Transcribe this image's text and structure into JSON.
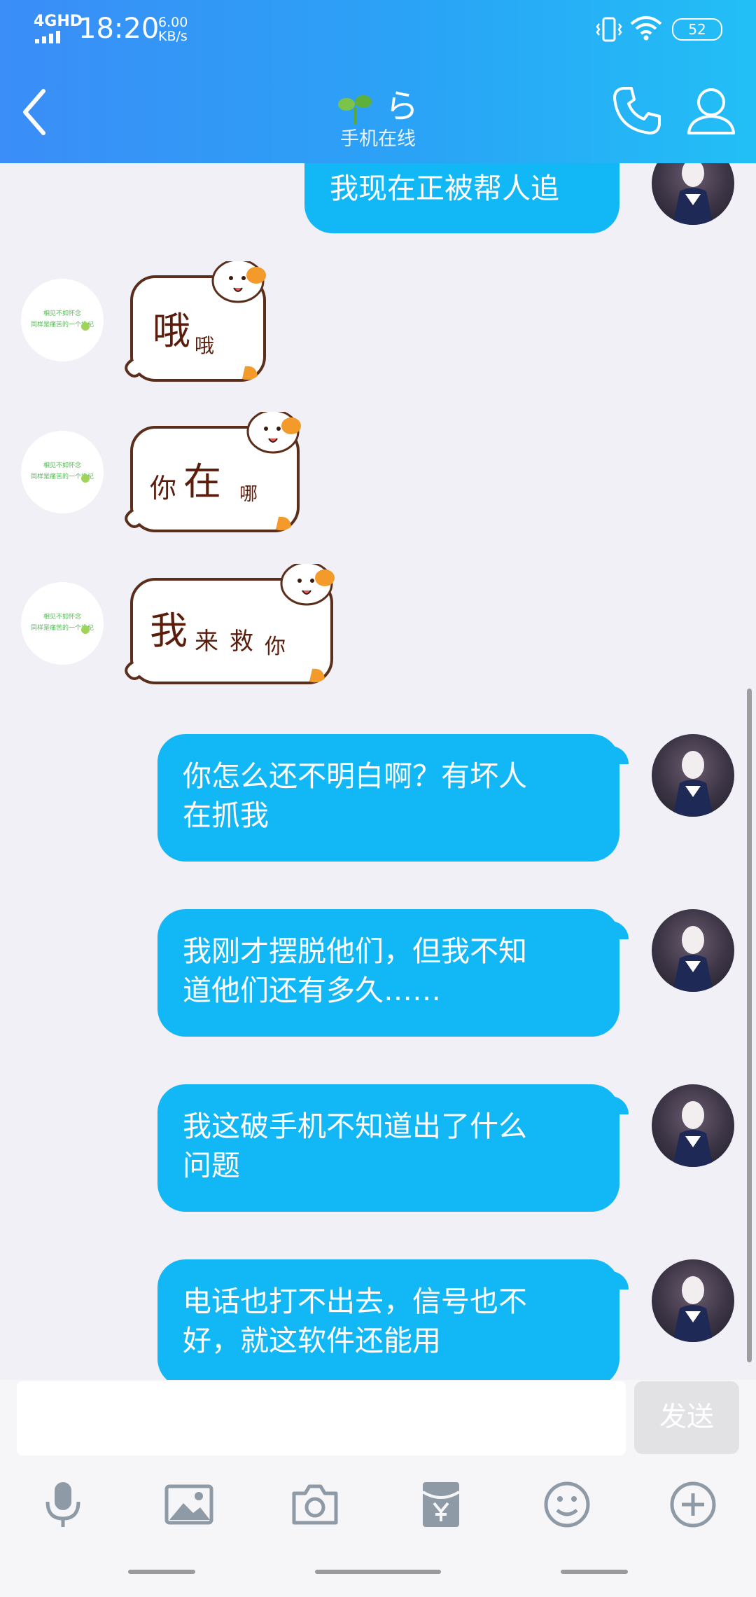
{
  "status_bar": {
    "network": "4GHD",
    "time": "18:20",
    "speed_value": "6.00",
    "speed_unit": "KB/s",
    "battery": "52"
  },
  "header": {
    "contact_name": "ら",
    "presence": "手机在线"
  },
  "messages": [
    {
      "from": "me",
      "type": "text",
      "text": "我现在正被帮人追"
    },
    {
      "from": "other",
      "type": "sticker",
      "sticker_text": [
        "哦",
        "哦"
      ]
    },
    {
      "from": "other",
      "type": "sticker",
      "sticker_text": [
        "你",
        "在",
        "哪"
      ]
    },
    {
      "from": "other",
      "type": "sticker",
      "sticker_text": [
        "我",
        "来",
        "救",
        "你"
      ]
    },
    {
      "from": "me",
      "type": "text",
      "line1": "你怎么还不明白啊？有坏人",
      "line2": "在抓我"
    },
    {
      "from": "me",
      "type": "text",
      "line1": "我刚才摆脱他们，但我不知",
      "line2": "道他们还有多久……"
    },
    {
      "from": "me",
      "type": "text",
      "line1": "我这破手机不知道出了什么",
      "line2": "问题"
    },
    {
      "from": "me",
      "type": "text",
      "line1": "电话也打不出去，信号也不",
      "line2": "好，就这软件还能用"
    }
  ],
  "other_avatar_text": [
    "相见不如怀念",
    "同样是痛苦的一个世纪"
  ],
  "composer": {
    "input_value": "",
    "send_label": "发送"
  },
  "toolbar_icons": [
    "microphone-icon",
    "image-icon",
    "camera-icon",
    "red-packet-icon",
    "emoji-icon",
    "plus-icon"
  ],
  "colors": {
    "bubble": "#12b7f5",
    "header_start": "#3b8df7",
    "header_end": "#22bff6",
    "background": "#f0f0f6",
    "icon": "#8e9aa6"
  }
}
